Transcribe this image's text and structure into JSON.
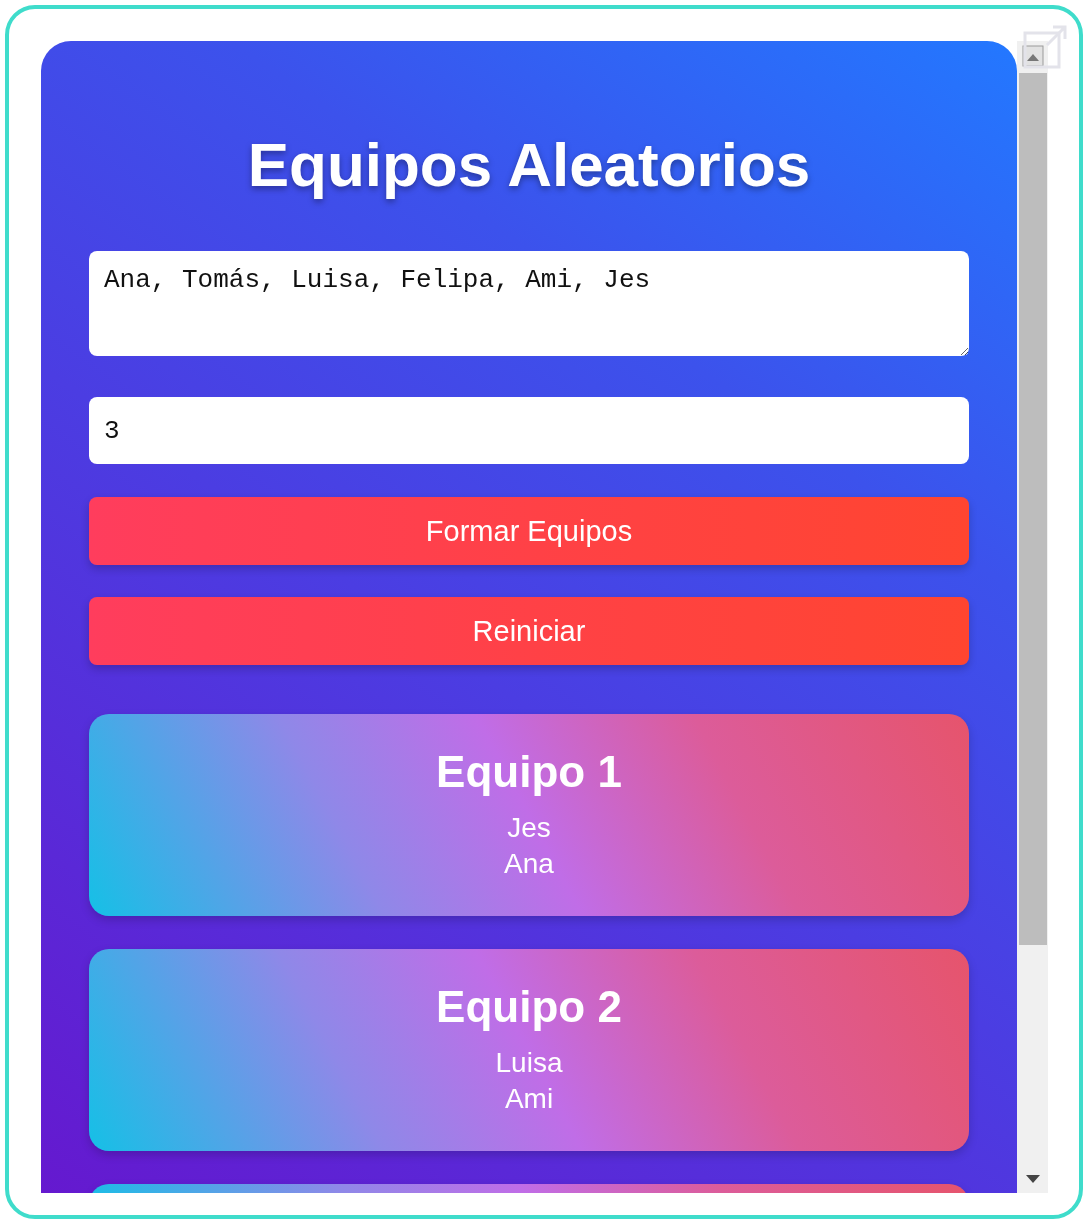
{
  "title": "Equipos Aleatorios",
  "names_field": {
    "value": "Ana, Tomás, Luisa, Felipa, Ami, Jes"
  },
  "team_count_field": {
    "value": "3"
  },
  "buttons": [
    {
      "label": "Formar Equipos"
    },
    {
      "label": "Reiniciar"
    }
  ],
  "teams": [
    {
      "title": "Equipo 1",
      "members": [
        "Jes",
        "Ana"
      ]
    },
    {
      "title": "Equipo 2",
      "members": [
        "Luisa",
        "Ami"
      ]
    }
  ]
}
